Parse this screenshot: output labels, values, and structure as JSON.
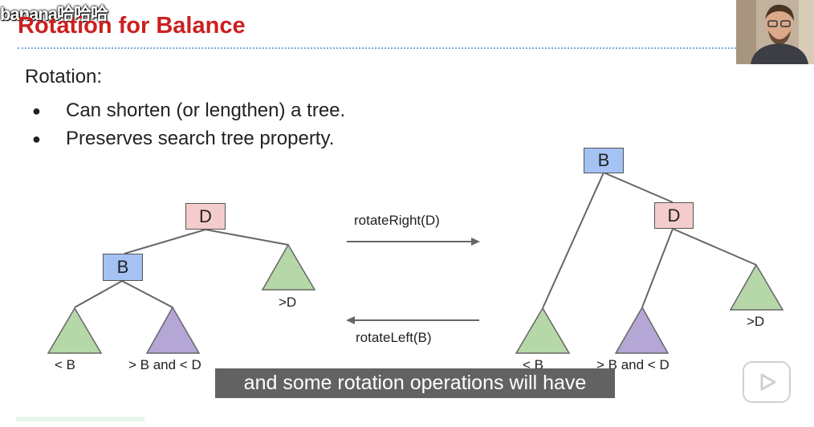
{
  "watermark": "banana哈哈哈",
  "slide": {
    "title": "Rotation for Balance",
    "heading": "Rotation:",
    "bullet_glyph": "●",
    "bullets": [
      "Can shorten (or lengthen) a tree.",
      "Preserves search tree property."
    ]
  },
  "left_tree": {
    "node_d": "D",
    "node_b": "B",
    "label_less_b": "< B",
    "label_between": "> B and < D",
    "label_greater_d": ">D"
  },
  "right_tree": {
    "node_b": "B",
    "node_d": "D",
    "label_less_b": "< B",
    "label_between": "> B and < D",
    "label_greater_d": ">D"
  },
  "arrows": {
    "rotate_right": "rotateRight(D)",
    "rotate_left": "rotateLeft(B)"
  },
  "subtitle": "and some rotation operations will have",
  "colors": {
    "title": "#cc1f1f",
    "pink_node": "#f4cccc",
    "blue_node": "#a4c2f4",
    "green_triangle": "#b6d7a8",
    "purple_triangle": "#b4a7d6",
    "dotted_rule": "#7ea6dd"
  },
  "icons": {
    "play": "play-icon",
    "webcam": "presenter-webcam"
  }
}
